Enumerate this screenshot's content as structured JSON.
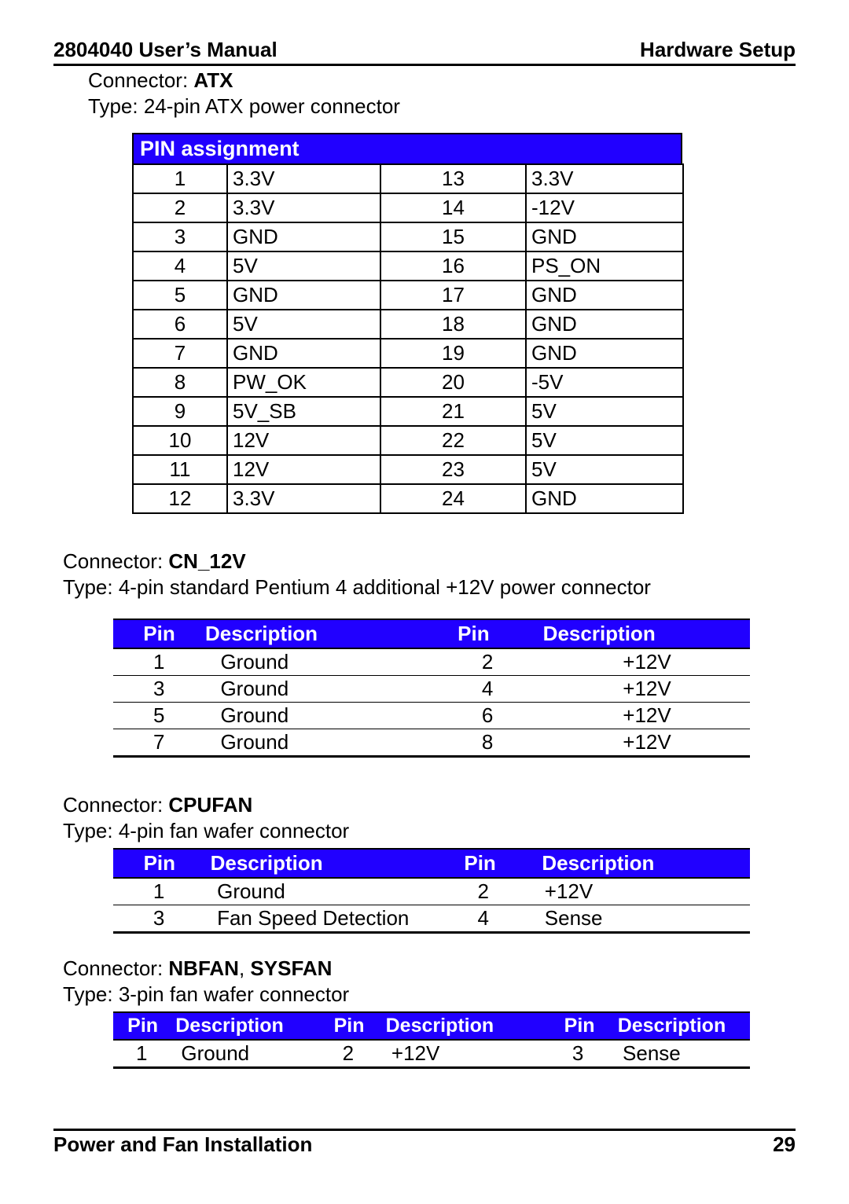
{
  "header": {
    "left": "2804040 User’s Manual",
    "right": "Hardware Setup"
  },
  "atx": {
    "connector_prefix": "Connector: ",
    "connector_name": "ATX",
    "type": "Type: 24-pin ATX power connector",
    "table_title": "PIN assignment",
    "rows": [
      {
        "p1": "1",
        "d1": "3.3V",
        "p2": "13",
        "d2": "3.3V"
      },
      {
        "p1": "2",
        "d1": "3.3V",
        "p2": "14",
        "d2": "-12V"
      },
      {
        "p1": "3",
        "d1": "GND",
        "p2": "15",
        "d2": "GND"
      },
      {
        "p1": "4",
        "d1": "5V",
        "p2": "16",
        "d2": "PS_ON"
      },
      {
        "p1": "5",
        "d1": "GND",
        "p2": "17",
        "d2": "GND"
      },
      {
        "p1": "6",
        "d1": "5V",
        "p2": "18",
        "d2": "GND"
      },
      {
        "p1": "7",
        "d1": "GND",
        "p2": "19",
        "d2": "GND"
      },
      {
        "p1": "8",
        "d1": "PW_OK",
        "p2": "20",
        "d2": "-5V"
      },
      {
        "p1": "9",
        "d1": "5V_SB",
        "p2": "21",
        "d2": "5V"
      },
      {
        "p1": "10",
        "d1": "12V",
        "p2": "22",
        "d2": "5V"
      },
      {
        "p1": "11",
        "d1": "12V",
        "p2": "23",
        "d2": "5V"
      },
      {
        "p1": "12",
        "d1": "3.3V",
        "p2": "24",
        "d2": "GND"
      }
    ]
  },
  "cn12v": {
    "connector_prefix": "Connector: ",
    "connector_name": "CN_12V",
    "type": "Type: 4-pin standard Pentium 4 additional +12V power connector",
    "h1": "Pin",
    "h2": "Description",
    "h3": "Pin",
    "h4": "Description",
    "rows": [
      {
        "p1": "1",
        "d1": "Ground",
        "p2": "2",
        "d2": "+12V"
      },
      {
        "p1": "3",
        "d1": "Ground",
        "p2": "4",
        "d2": "+12V"
      },
      {
        "p1": "5",
        "d1": "Ground",
        "p2": "6",
        "d2": "+12V"
      },
      {
        "p1": "7",
        "d1": "Ground",
        "p2": "8",
        "d2": "+12V"
      }
    ]
  },
  "cpufan": {
    "connector_prefix": "Connector: ",
    "connector_name": "CPUFAN",
    "type": "Type: 4-pin fan wafer connector",
    "h1": "Pin",
    "h2": "Description",
    "h3": "Pin",
    "h4": "Description",
    "rows": [
      {
        "p1": "1",
        "d1": "Ground",
        "p2": "2",
        "d2": "+12V"
      },
      {
        "p1": "3",
        "d1": "Fan Speed Detection",
        "p2": "4",
        "d2": "Sense"
      }
    ]
  },
  "nbfan": {
    "connector_prefix": "Connector: ",
    "connector_name": "NBFAN",
    "connector_sep": ", ",
    "connector_name2": "SYSFAN",
    "type": "Type: 3-pin fan wafer connector",
    "h1": "Pin",
    "h2": "Description",
    "h3": "Pin",
    "h4": "Description",
    "h5": "Pin",
    "h6": "Description",
    "rows": [
      {
        "p1": "1",
        "d1": "Ground",
        "p2": "2",
        "d2": "+12V",
        "p3": "3",
        "d3": "Sense"
      }
    ]
  },
  "footer": {
    "left": "Power and Fan Installation",
    "right": "29"
  }
}
